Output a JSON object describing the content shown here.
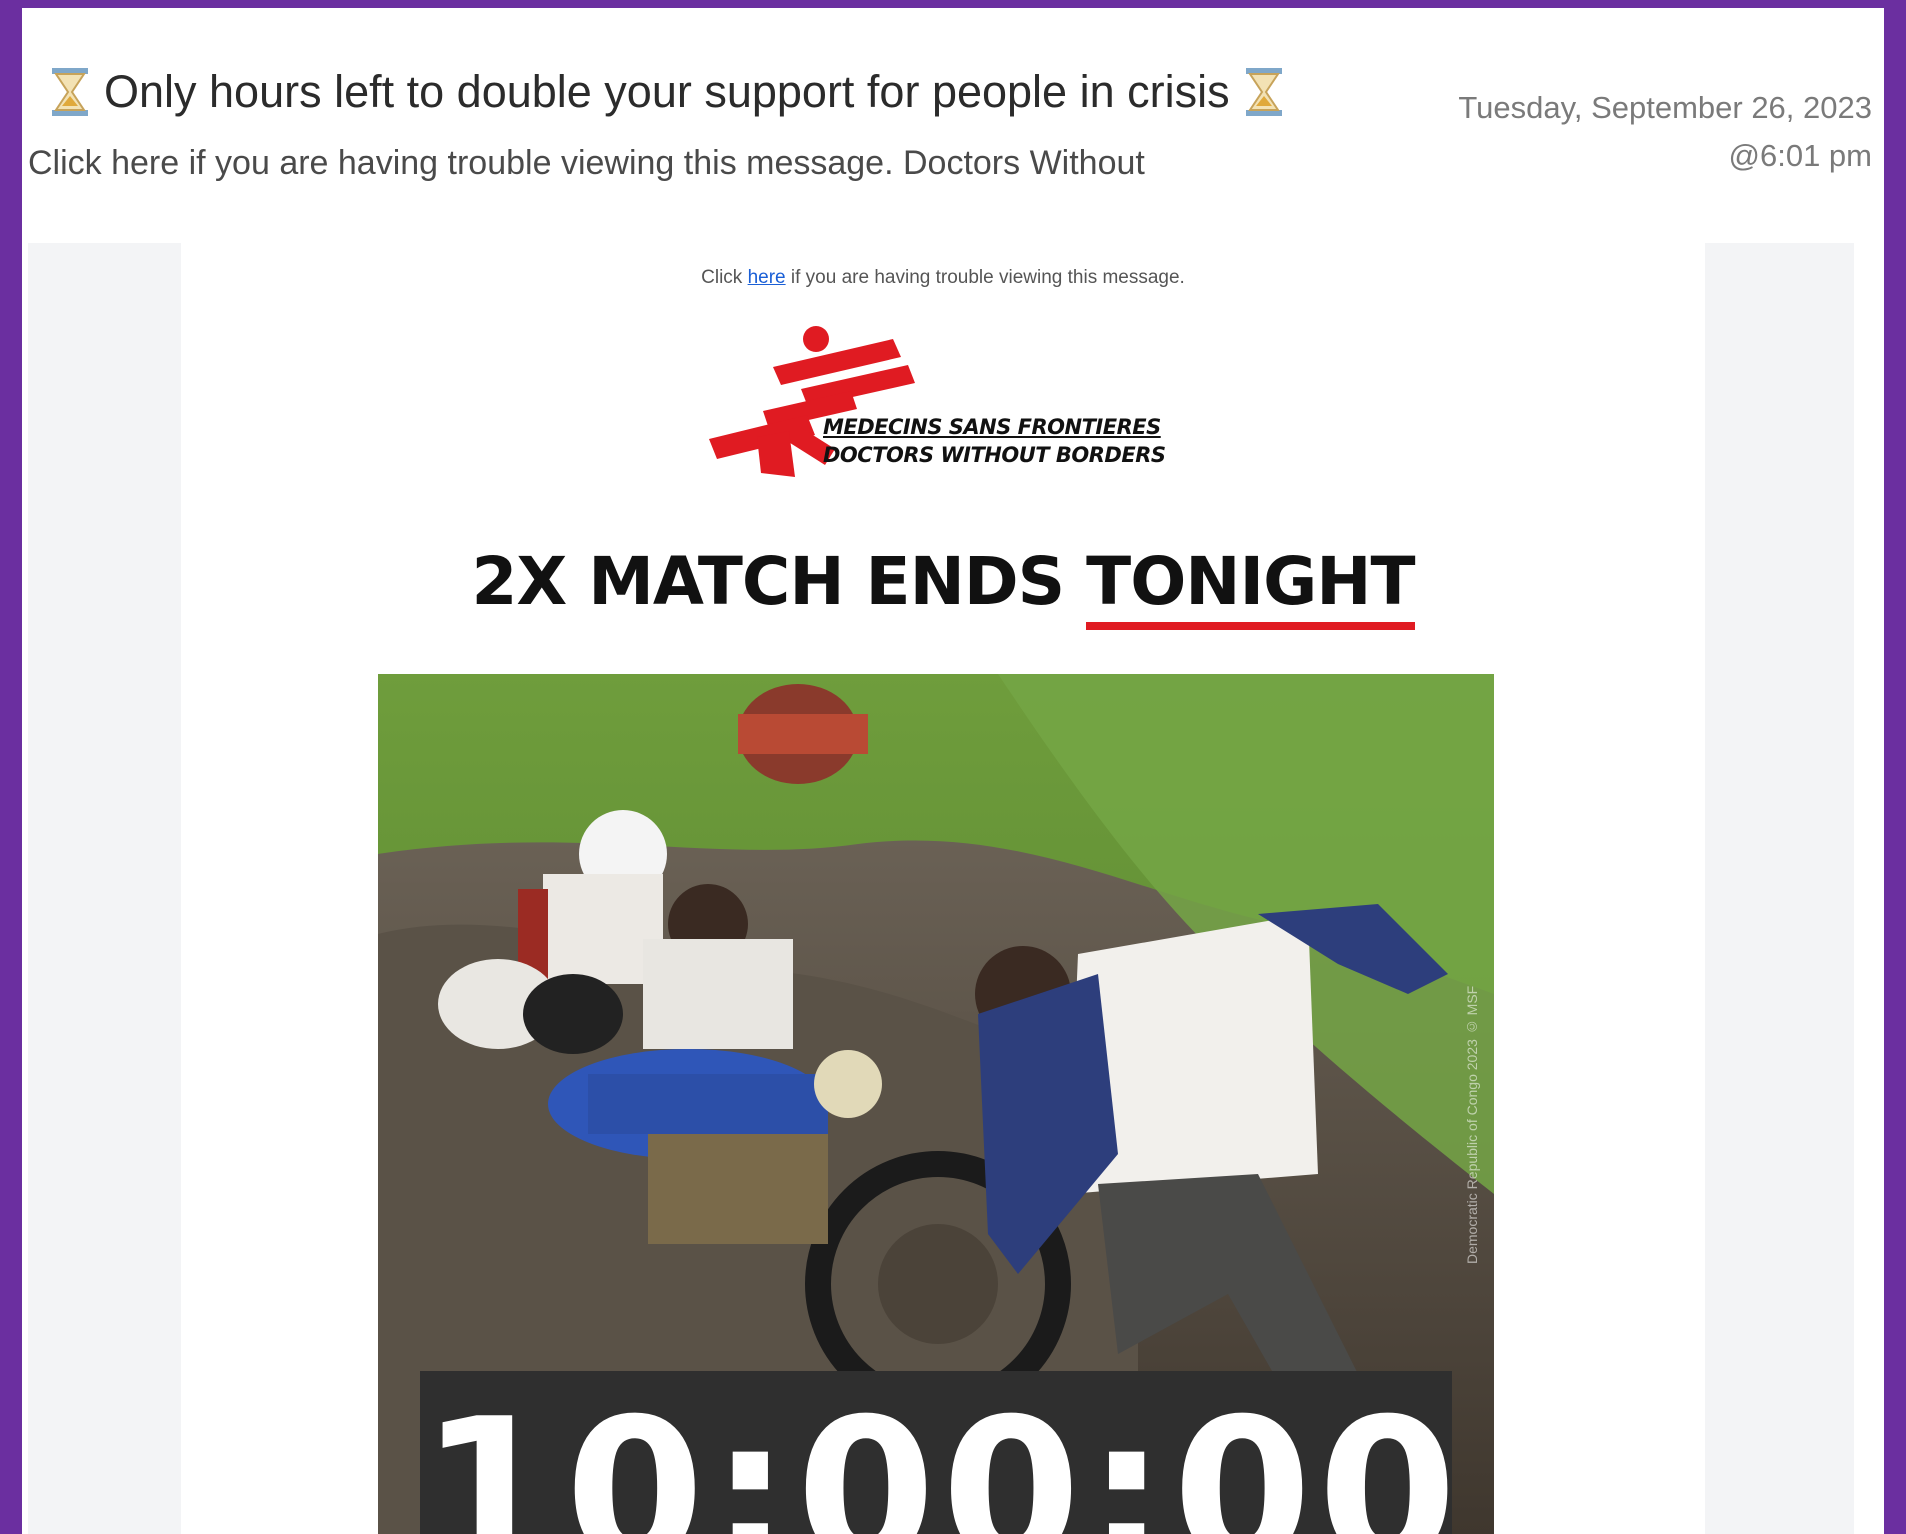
{
  "email": {
    "subject": "Only hours left to double your support for people in crisis",
    "preview": "Click here if you are having trouble viewing this message. Doctors Without",
    "date": "Tuesday, September 26, 2023",
    "time": "@6:01 pm"
  },
  "body": {
    "trouble_prefix": "Click",
    "trouble_link": "here",
    "trouble_suffix": "if you are having trouble viewing this message.",
    "logo_line_1": "MEDECINS SANS FRONTIERES",
    "logo_line_2": "DOCTORS WITHOUT BORDERS",
    "headline_main": "2X MATCH ENDS",
    "headline_accent": "TONIGHT",
    "countdown": "10:00:00"
  },
  "colors": {
    "frame": "#6b2fa0",
    "brand_red": "#e01b22",
    "countdown_bg": "#2f2f2f"
  },
  "icons": [
    "hourglass-icon",
    "msf-logo-icon"
  ]
}
